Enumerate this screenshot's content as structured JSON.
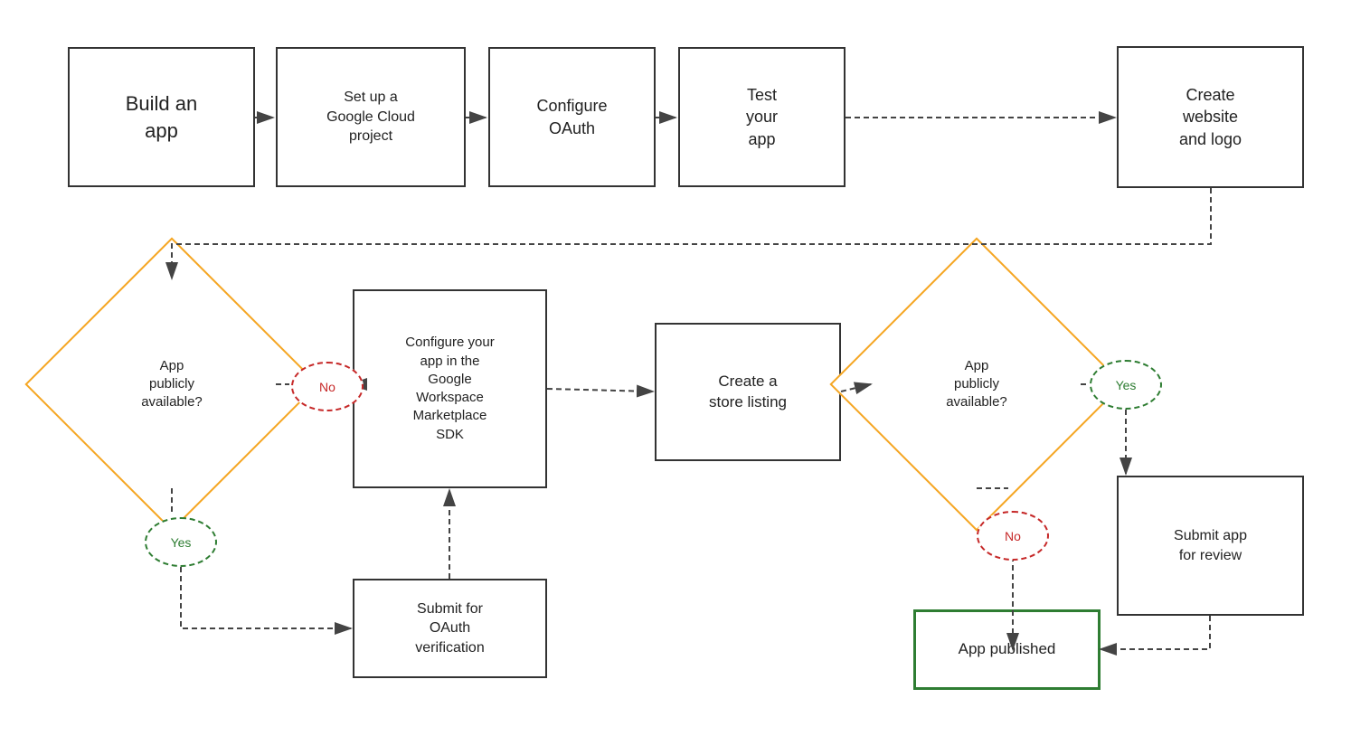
{
  "boxes": {
    "build_app": {
      "label": "Build an\napp"
    },
    "google_cloud": {
      "label": "Set up a\nGoogle Cloud\nproject"
    },
    "configure_oauth": {
      "label": "Configure\nOAuth"
    },
    "test_app": {
      "label": "Test\nyour\napp"
    },
    "create_website": {
      "label": "Create\nwebsite\nand logo"
    },
    "configure_workspace": {
      "label": "Configure your\napp in the\nGoogle\nWorkspace\nMarketplace\nSDK"
    },
    "create_store": {
      "label": "Create a\nstore listing"
    },
    "submit_oauth": {
      "label": "Submit for\nOAuth\nverification"
    },
    "submit_review": {
      "label": "Submit app\nfor review"
    },
    "app_published": {
      "label": "App published"
    }
  },
  "diamonds": {
    "app_avail_left": {
      "label": "App\npublicly\navailable?"
    },
    "app_avail_right": {
      "label": "App\npublicly\navailable?"
    }
  },
  "ovals": {
    "no_left": {
      "label": "No"
    },
    "yes_left": {
      "label": "Yes"
    },
    "no_right": {
      "label": "No"
    },
    "yes_right": {
      "label": "Yes"
    }
  },
  "colors": {
    "diamond_border": "#f5a623",
    "green_border": "#2e7d32",
    "red_oval": "#c62828",
    "green_oval": "#2e7d32",
    "arrow": "#444"
  }
}
